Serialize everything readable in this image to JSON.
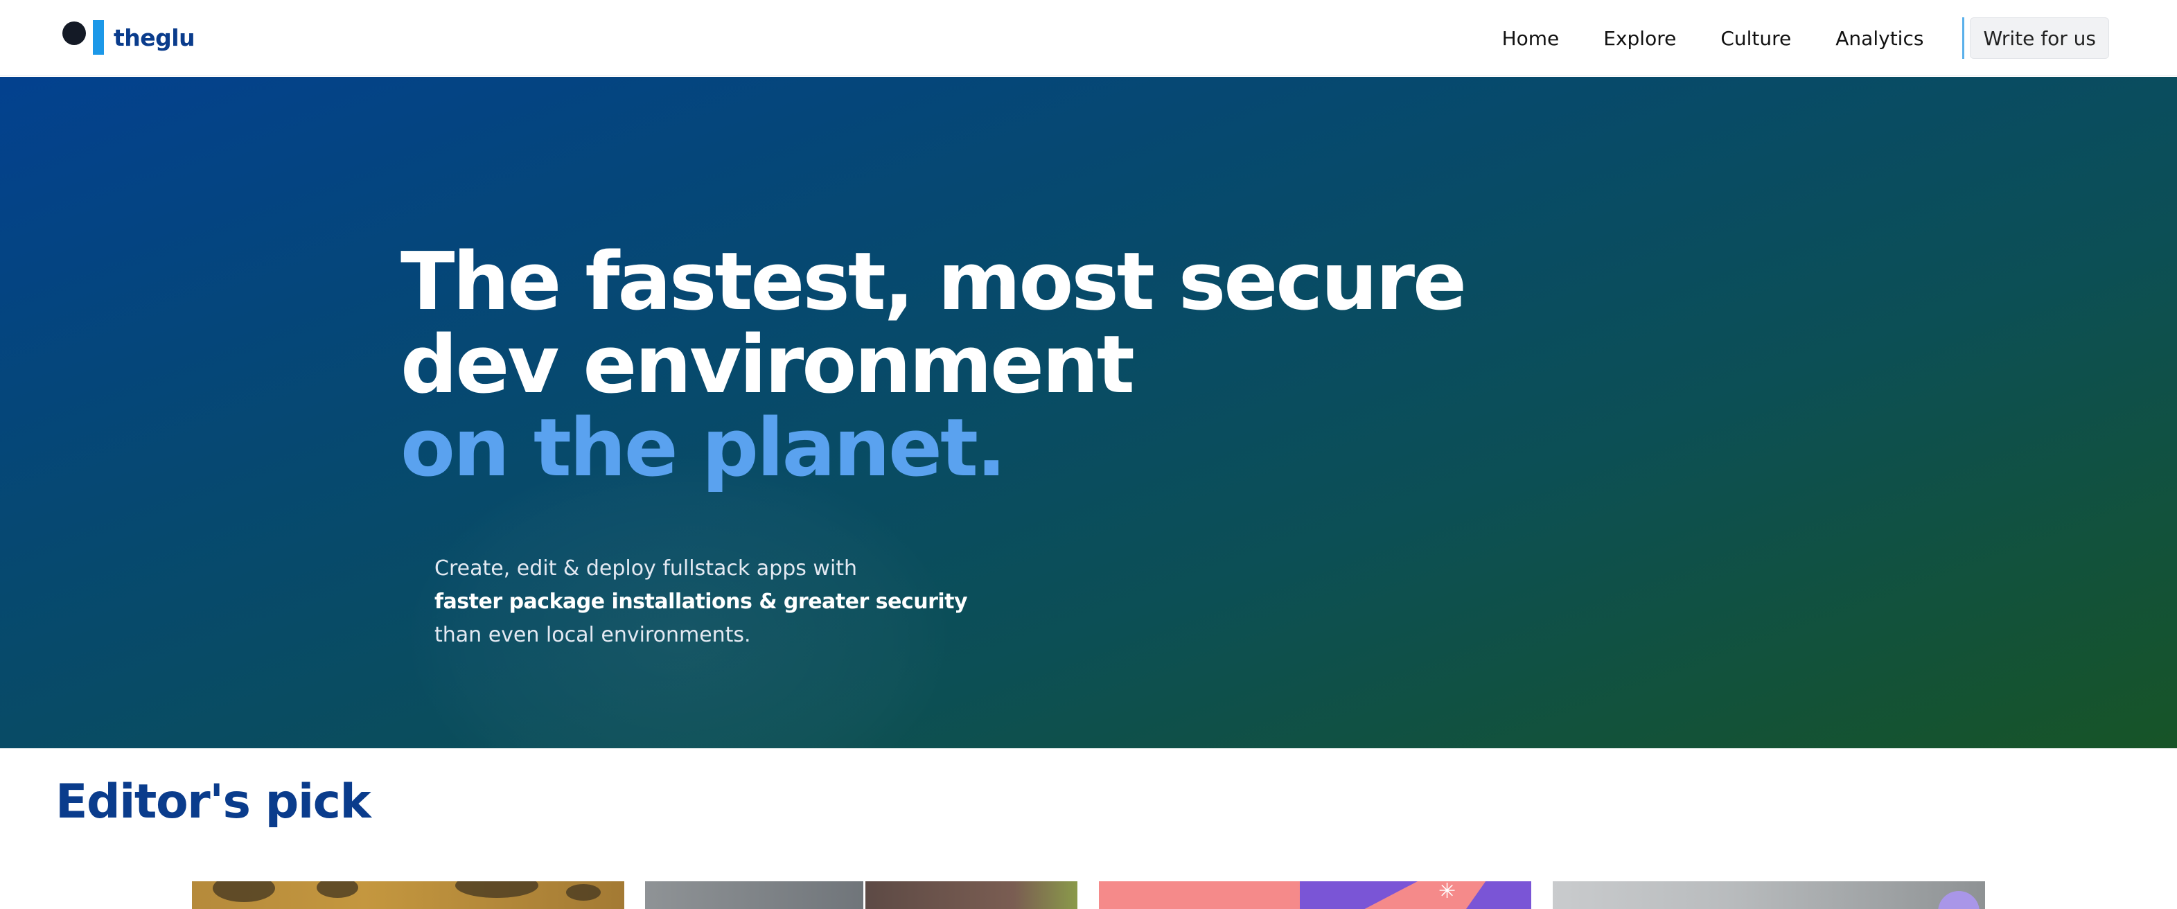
{
  "header": {
    "brand": "theglu",
    "nav": [
      "Home",
      "Explore",
      "Culture",
      "Analytics"
    ],
    "cta_label": "Write for us"
  },
  "hero": {
    "title_line1": "The fastest, most secure",
    "title_line2": "dev environment",
    "title_line3": "on the planet.",
    "sub_line1": "Create, edit & deploy fullstack apps with",
    "sub_line2": "faster package installations & greater security",
    "sub_line3": "than even local environments."
  },
  "editors_pick": {
    "title": "Editor's pick"
  },
  "colors": {
    "brand_blue": "#0a3c8c",
    "accent_light_blue": "#5aa2ef",
    "logo_bar": "#1c98e8",
    "hero_gradient_start": "#03418f",
    "hero_gradient_end": "#175427"
  }
}
